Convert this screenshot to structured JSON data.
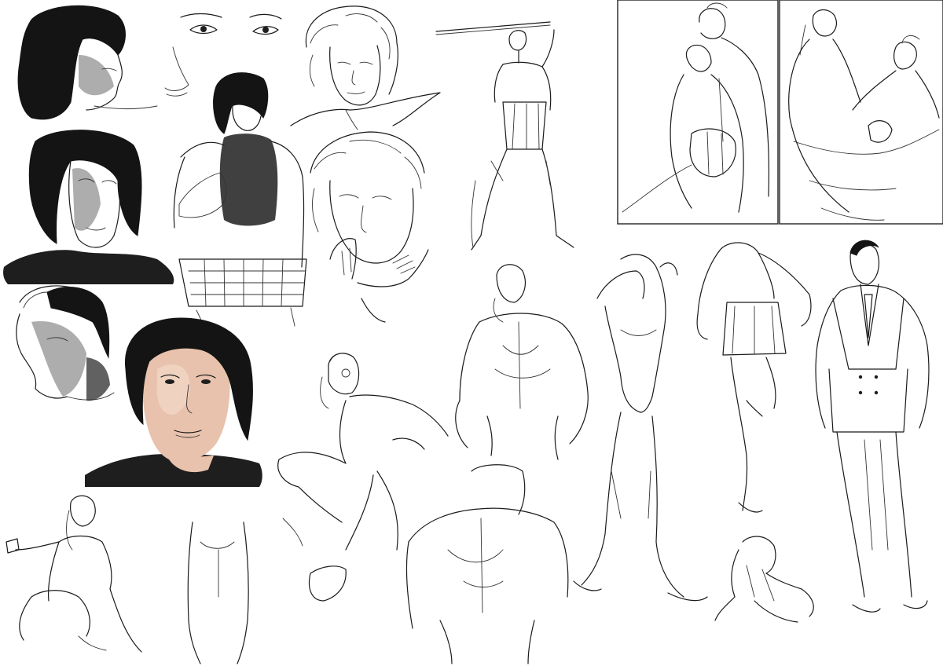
{
  "sheet": {
    "background": "#ffffff",
    "ink": "#1a1a1a",
    "accent_skin": "#e8c2ac"
  }
}
